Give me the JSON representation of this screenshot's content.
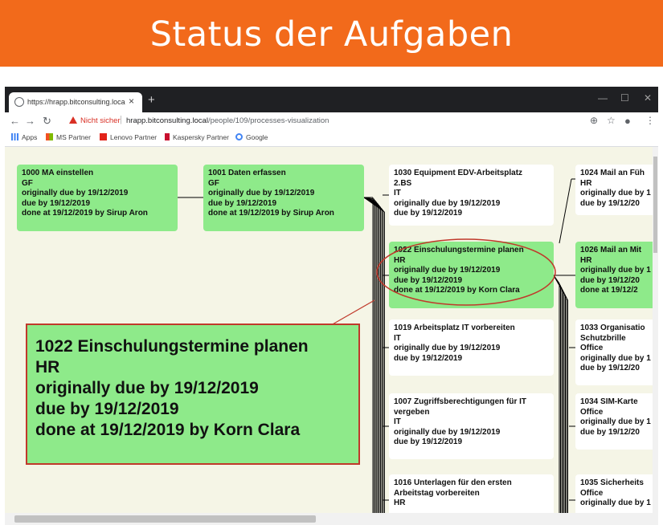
{
  "banner": {
    "title": "Status der Aufgaben"
  },
  "browser": {
    "tab_title": "https://hrapp.bitconsulting.local/",
    "tab_close": "×",
    "new_tab": "+",
    "insecure_label": "Nicht sicher",
    "url_host": "hrapp.bitconsulting.local",
    "url_path": "/people/109/processes-visualization",
    "bookmarks": [
      {
        "label": "Apps",
        "color": "#4285f4"
      },
      {
        "label": "MS Partner",
        "color": "#f25022"
      },
      {
        "label": "Lenovo Partner",
        "color": "#e2231a"
      },
      {
        "label": "Kaspersky Partner",
        "color": "#c8102e"
      },
      {
        "label": "Google",
        "color": "#4285f4"
      }
    ]
  },
  "tasks": [
    {
      "id": "t1000",
      "lines": [
        "1000 MA einstellen",
        "GF",
        "originally due by 19/12/2019",
        "due by 19/12/2019",
        "done at 19/12/2019 by Sirup Aron"
      ],
      "status": "done"
    },
    {
      "id": "t1001",
      "lines": [
        "1001 Daten erfassen",
        "GF",
        "originally due by 19/12/2019",
        "due by 19/12/2019",
        "done at 19/12/2019 by Sirup Aron"
      ],
      "status": "done"
    },
    {
      "id": "t1030",
      "lines": [
        "1030 Equipment EDV-Arbeitsplatz",
        "2.BS",
        "IT",
        "originally due by 19/12/2019",
        "due by 19/12/2019"
      ],
      "status": "open"
    },
    {
      "id": "t1022",
      "lines": [
        "1022 Einschulungstermine planen",
        "HR",
        "originally due by 19/12/2019",
        "due by 19/12/2019",
        "done at 19/12/2019 by Korn Clara"
      ],
      "status": "done"
    },
    {
      "id": "t1019",
      "lines": [
        "1019 Arbeitsplatz IT vorbereiten",
        "IT",
        "originally due by 19/12/2019",
        "due by 19/12/2019"
      ],
      "status": "open"
    },
    {
      "id": "t1007",
      "lines": [
        "1007 Zugriffsberechtigungen für IT",
        "vergeben",
        "IT",
        "originally due by 19/12/2019",
        "due by 19/12/2019"
      ],
      "status": "open"
    },
    {
      "id": "t1016",
      "lines": [
        "1016 Unterlagen für den ersten",
        "Arbeitstag vorbereiten",
        "HR"
      ],
      "status": "open"
    },
    {
      "id": "t1024",
      "lines": [
        "1024 Mail an Füh",
        "HR",
        "originally due by 1",
        "due by 19/12/20"
      ],
      "status": "open"
    },
    {
      "id": "t1026",
      "lines": [
        "1026 Mail an Mit",
        "HR",
        "originally due by 1",
        "due by 19/12/20",
        "done at 19/12/2"
      ],
      "status": "done"
    },
    {
      "id": "t1033",
      "lines": [
        "1033 Organisatio",
        "Schutzbrille",
        "Office",
        "originally due by 1",
        "due by 19/12/20"
      ],
      "status": "open"
    },
    {
      "id": "t1034",
      "lines": [
        "1034 SIM-Karte",
        "Office",
        "originally due by 1",
        "due by 19/12/20"
      ],
      "status": "open"
    },
    {
      "id": "t1035",
      "lines": [
        "1035 Sicherheits",
        "Office",
        "originally due by 1"
      ],
      "status": "open"
    }
  ],
  "zoom": {
    "lines": [
      "1022 Einschulungstermine planen",
      "HR",
      "originally due by 19/12/2019",
      "due by 19/12/2019",
      "done at 19/12/2019 by Korn Clara"
    ]
  },
  "colors": {
    "banner": "#f26a1b",
    "done": "#8eea8a",
    "open": "#ffffff",
    "highlight": "#c0392b",
    "canvas": "#f5f5e6"
  }
}
